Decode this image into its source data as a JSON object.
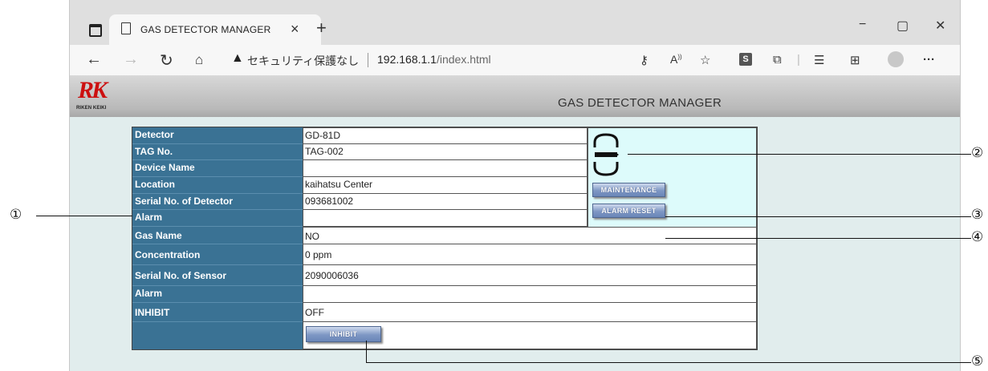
{
  "browser": {
    "tab_title": "GAS DETECTOR MANAGER",
    "tab_close": "×",
    "new_tab": "+",
    "window_controls": {
      "minimize": "−",
      "maximize": "▢",
      "close": "✕"
    },
    "security_warning": "セキュリティ保護なし",
    "url_host": "192.168.1.1",
    "url_path": "/index.html",
    "nav_icons": [
      "back-icon",
      "forward-icon",
      "reload-icon",
      "home-icon"
    ],
    "right_icons": [
      "key-icon",
      "read-aloud-icon",
      "favorite-add-icon",
      "s-extension-icon",
      "extensions-icon",
      "favorites-icon",
      "collections-icon",
      "profile-avatar",
      "more-icon"
    ],
    "s_badge": "S",
    "more": "···"
  },
  "header": {
    "logo_letters": "RK",
    "logo_text": "RIKEN KEIKI",
    "app_title": "GAS DETECTOR MANAGER"
  },
  "detector_table": {
    "rows": [
      {
        "label": "Detector",
        "value": "GD-81D"
      },
      {
        "label": "TAG No.",
        "value": "TAG-002"
      },
      {
        "label": "Device Name",
        "value": ""
      },
      {
        "label": "Location",
        "value": "kaihatsu Center"
      },
      {
        "label": "Serial No. of Detector",
        "value": "093681002"
      },
      {
        "label": "Alarm",
        "value": ""
      }
    ]
  },
  "sensor_table": {
    "rows": [
      {
        "label": "Gas Name",
        "value": "NO"
      },
      {
        "label": "Concentration",
        "value": "0 ppm"
      },
      {
        "label": "Serial No. of Sensor",
        "value": "2090006036"
      },
      {
        "label": "Alarm",
        "value": ""
      },
      {
        "label": "INHIBIT",
        "value": "OFF"
      }
    ]
  },
  "buttons": {
    "maintenance": "MAINTENANCE",
    "alarm_reset": "ALARM RESET",
    "inhibit": "INHIBIT"
  },
  "callouts": [
    "①",
    "②",
    "③",
    "④",
    "⑤"
  ],
  "colors": {
    "label_bg": "#3a7294",
    "status_panel_bg": "#ddfbfb",
    "page_bg": "#e1eded",
    "logo_red": "#cc1010",
    "button_blue": "#7e97c4"
  }
}
